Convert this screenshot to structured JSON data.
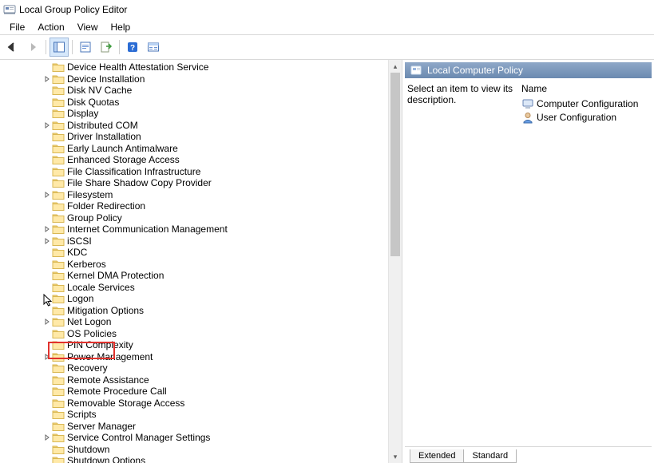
{
  "title": "Local Group Policy Editor",
  "menu": {
    "file": "File",
    "action": "Action",
    "view": "View",
    "help": "Help"
  },
  "tree": [
    {
      "label": "Device Health Attestation Service",
      "expandable": false
    },
    {
      "label": "Device Installation",
      "expandable": true
    },
    {
      "label": "Disk NV Cache",
      "expandable": false
    },
    {
      "label": "Disk Quotas",
      "expandable": false
    },
    {
      "label": "Display",
      "expandable": false
    },
    {
      "label": "Distributed COM",
      "expandable": true
    },
    {
      "label": "Driver Installation",
      "expandable": false
    },
    {
      "label": "Early Launch Antimalware",
      "expandable": false
    },
    {
      "label": "Enhanced Storage Access",
      "expandable": false
    },
    {
      "label": "File Classification Infrastructure",
      "expandable": false
    },
    {
      "label": "File Share Shadow Copy Provider",
      "expandable": false
    },
    {
      "label": "Filesystem",
      "expandable": true
    },
    {
      "label": "Folder Redirection",
      "expandable": false
    },
    {
      "label": "Group Policy",
      "expandable": false
    },
    {
      "label": "Internet Communication Management",
      "expandable": true
    },
    {
      "label": "iSCSI",
      "expandable": true
    },
    {
      "label": "KDC",
      "expandable": false
    },
    {
      "label": "Kerberos",
      "expandable": false
    },
    {
      "label": "Kernel DMA Protection",
      "expandable": false
    },
    {
      "label": "Locale Services",
      "expandable": false
    },
    {
      "label": "Logon",
      "expandable": false,
      "highlighted": true
    },
    {
      "label": "Mitigation Options",
      "expandable": false
    },
    {
      "label": "Net Logon",
      "expandable": true
    },
    {
      "label": "OS Policies",
      "expandable": false
    },
    {
      "label": "PIN Complexity",
      "expandable": false
    },
    {
      "label": "Power Management",
      "expandable": true
    },
    {
      "label": "Recovery",
      "expandable": false
    },
    {
      "label": "Remote Assistance",
      "expandable": false
    },
    {
      "label": "Remote Procedure Call",
      "expandable": false
    },
    {
      "label": "Removable Storage Access",
      "expandable": false
    },
    {
      "label": "Scripts",
      "expandable": false
    },
    {
      "label": "Server Manager",
      "expandable": false
    },
    {
      "label": "Service Control Manager Settings",
      "expandable": true
    },
    {
      "label": "Shutdown",
      "expandable": false
    },
    {
      "label": "Shutdown Options",
      "expandable": false
    }
  ],
  "right": {
    "header": "Local Computer Policy",
    "desc": "Select an item to view its description.",
    "name_col": "Name",
    "items": [
      {
        "label": "Computer Configuration",
        "icon": "computer"
      },
      {
        "label": "User Configuration",
        "icon": "user"
      }
    ]
  },
  "tabs": {
    "extended": "Extended",
    "standard": "Standard"
  }
}
